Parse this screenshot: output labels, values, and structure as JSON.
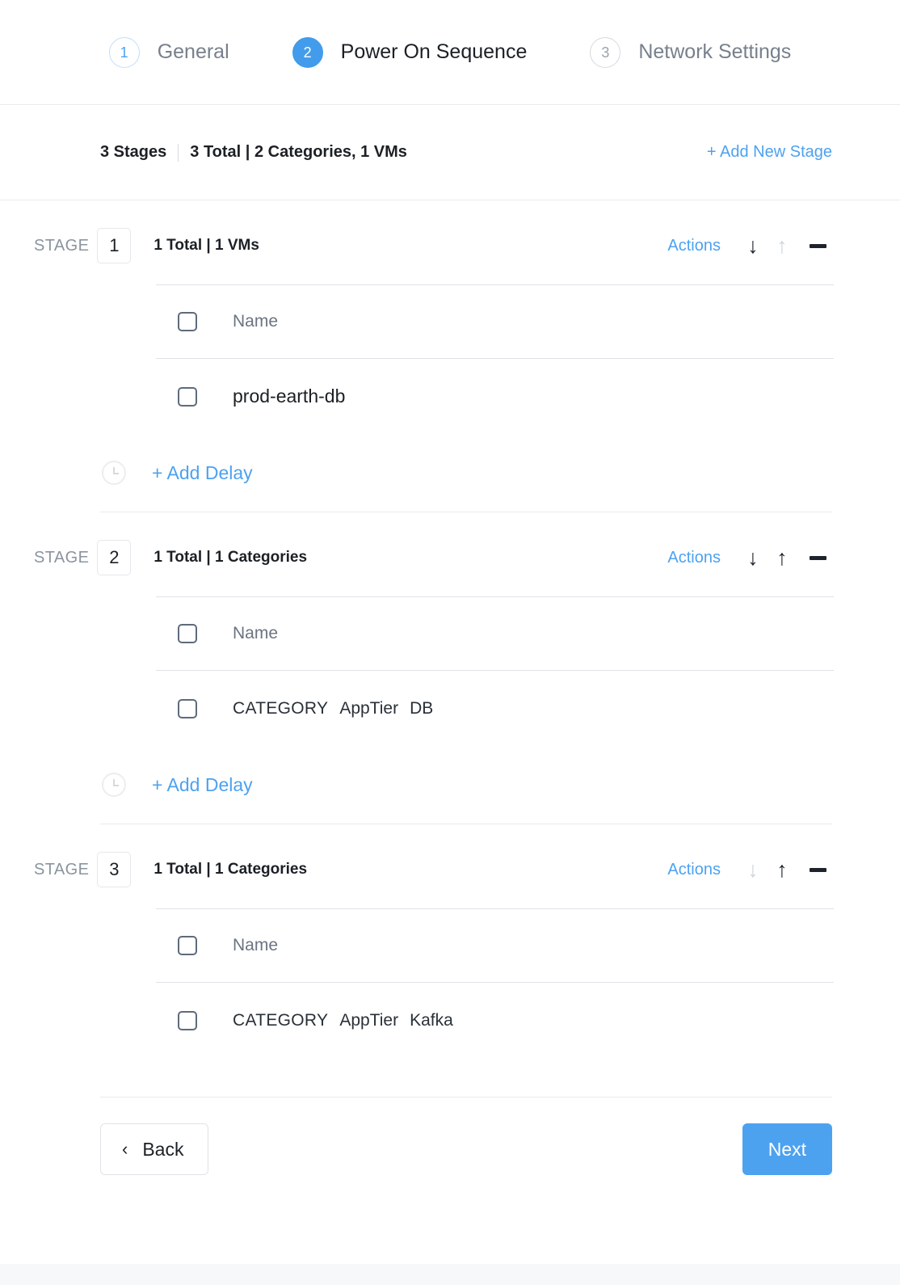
{
  "wizard": {
    "steps": [
      {
        "number": "1",
        "label": "General",
        "state": "done"
      },
      {
        "number": "2",
        "label": "Power On Sequence",
        "state": "active"
      },
      {
        "number": "3",
        "label": "Network Settings",
        "state": "todo"
      }
    ]
  },
  "summary": {
    "stages_count": "3 Stages",
    "totals": "3 Total | 2 Categories, 1 VMs",
    "add_new_stage_label": "+ Add New Stage"
  },
  "stage_word": "STAGE",
  "actions_label": "Actions",
  "add_delay_label": "+ Add Delay",
  "table_header_name": "Name",
  "stages": [
    {
      "number": "1",
      "counts": "1 Total | 1 VMs",
      "move_down_enabled": true,
      "move_up_enabled": false,
      "has_add_delay": true,
      "rows": [
        {
          "type": "vm",
          "name": "prod-earth-db"
        }
      ]
    },
    {
      "number": "2",
      "counts": "1 Total | 1 Categories",
      "move_down_enabled": true,
      "move_up_enabled": true,
      "has_add_delay": true,
      "rows": [
        {
          "type": "category",
          "kind": "CATEGORY",
          "key": "AppTier",
          "value": "DB"
        }
      ]
    },
    {
      "number": "3",
      "counts": "1 Total | 1 Categories",
      "move_down_enabled": false,
      "move_up_enabled": true,
      "has_add_delay": false,
      "rows": [
        {
          "type": "category",
          "kind": "CATEGORY",
          "key": "AppTier",
          "value": "Kafka"
        }
      ]
    }
  ],
  "footer": {
    "back_label": "Back",
    "next_label": "Next",
    "back_chevron": "‹"
  },
  "icons": {
    "arrow_down": "↓",
    "arrow_up": "↑"
  },
  "colors": {
    "accent": "#4da2f0",
    "active_step": "#429ceb",
    "text": "#1c2025",
    "muted": "#77808c",
    "rule": "#e8eaed"
  }
}
